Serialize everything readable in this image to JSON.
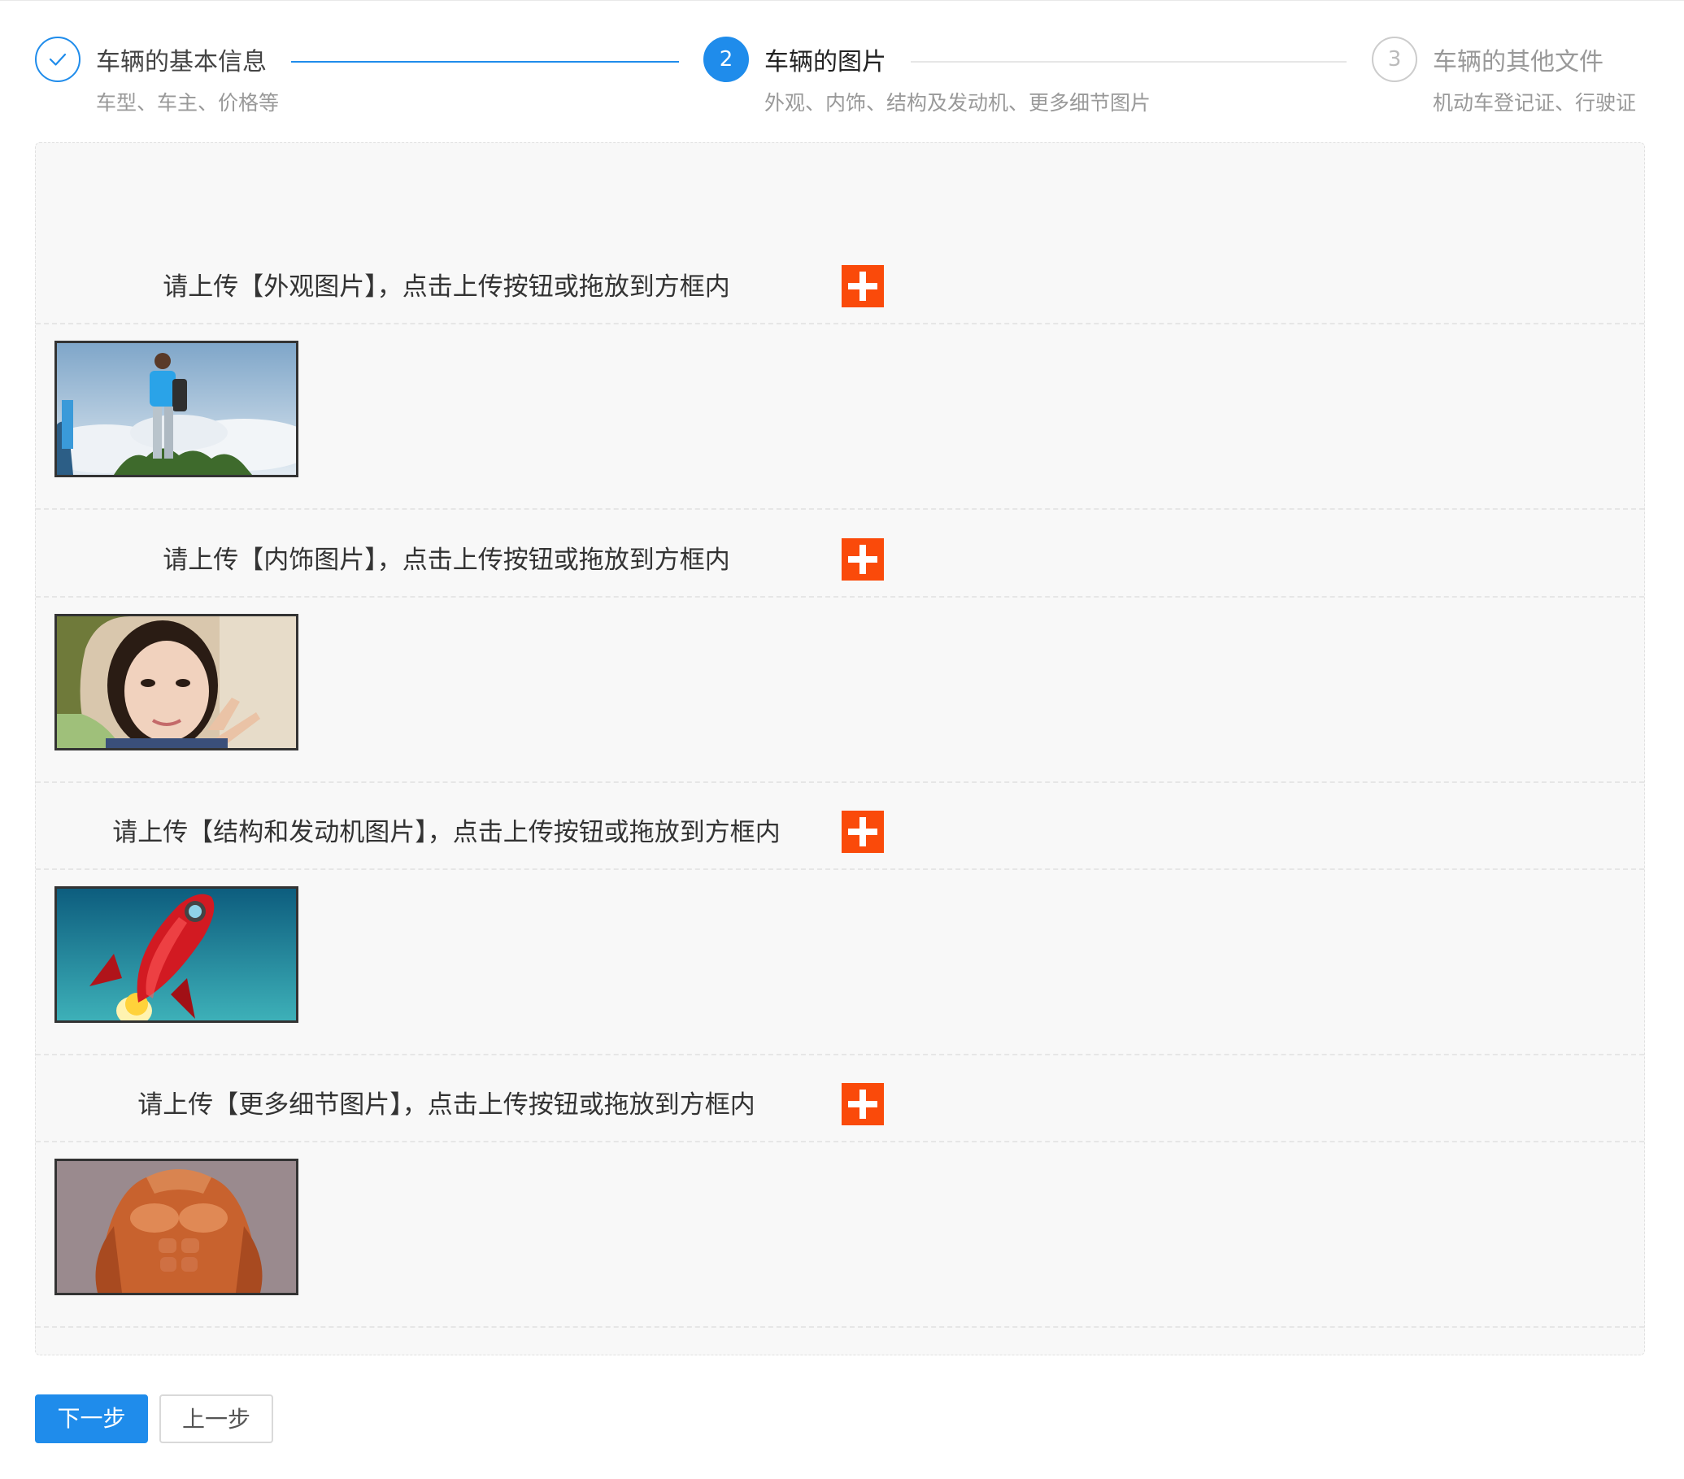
{
  "steps": [
    {
      "number": "",
      "icon": "check-icon",
      "title": "车辆的基本信息",
      "desc": "车型、车主、价格等",
      "status": "done"
    },
    {
      "number": "2",
      "title": "车辆的图片",
      "desc": "外观、内饰、结构及发动机、更多细节图片",
      "status": "active"
    },
    {
      "number": "3",
      "title": "车辆的其他文件",
      "desc": "机动车登记证、行驶证",
      "status": "wait"
    }
  ],
  "uploads": [
    {
      "label": "请上传【外观图片】，点击上传按钮或拖放到方框内",
      "thumbnail": "man-with-backpack-on-hill"
    },
    {
      "label": "请上传【内饰图片】，点击上传按钮或拖放到方框内",
      "thumbnail": "woman-selfie"
    },
    {
      "label": "请上传【结构和发动机图片】，点击上传按钮或拖放到方框内",
      "thumbnail": "red-rocket"
    },
    {
      "label": "请上传【更多细节图片】，点击上传按钮或拖放到方框内",
      "thumbnail": "muscular-torso"
    }
  ],
  "buttons": {
    "next": "下一步",
    "prev": "上一步"
  },
  "colors": {
    "primary": "#1f8ceb",
    "add": "#fa4a0a"
  }
}
